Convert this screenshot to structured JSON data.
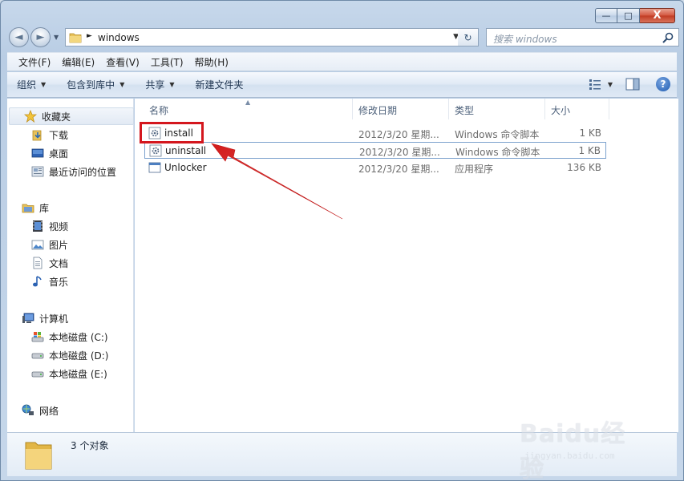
{
  "window": {
    "caption": {
      "minimize": "—",
      "maximize": "□",
      "close": "X"
    }
  },
  "nav": {
    "back_glyph": "◄",
    "forward_glyph": "►",
    "address_path": "windows",
    "refresh_glyph": "↻",
    "search_placeholder": "搜索 windows",
    "icons": {
      "search": "search-icon",
      "folder": "folder-icon"
    }
  },
  "menu": {
    "items": [
      "文件(F)",
      "编辑(E)",
      "查看(V)",
      "工具(T)",
      "帮助(H)"
    ]
  },
  "toolbar": {
    "organize": "组织",
    "include_in_library": "包含到库中",
    "share": "共享",
    "new_folder": "新建文件夹",
    "help": "?"
  },
  "nav_pane": {
    "favorites": {
      "label": "收藏夹",
      "items": [
        "下载",
        "桌面",
        "最近访问的位置"
      ]
    },
    "libraries": {
      "label": "库",
      "items": [
        "视频",
        "图片",
        "文档",
        "音乐"
      ]
    },
    "computer": {
      "label": "计算机",
      "items": [
        "本地磁盘 (C:)",
        "本地磁盘 (D:)",
        "本地磁盘 (E:)"
      ]
    },
    "network": {
      "label": "网络"
    }
  },
  "columns": {
    "name": "名称",
    "date": "修改日期",
    "type": "类型",
    "size": "大小"
  },
  "files": [
    {
      "name": "install",
      "date": "2012/3/20 星期...",
      "type": "Windows 命令脚本",
      "size": "1 KB",
      "icon": "script-gear-icon"
    },
    {
      "name": "uninstall",
      "date": "2012/3/20 星期...",
      "type": "Windows 命令脚本",
      "size": "1 KB",
      "icon": "script-gear-icon"
    },
    {
      "name": "Unlocker",
      "date": "2012/3/20 星期...",
      "type": "应用程序",
      "size": "136 KB",
      "icon": "application-icon"
    }
  ],
  "annotation": {
    "highlight_color": "#d4171e"
  },
  "status": {
    "count": "3 个对象"
  },
  "watermark": {
    "logo": "Baidu经验",
    "url": "jingyan.baidu.com"
  },
  "colors": {
    "accent": "#1d5bb2",
    "selection_border": "#7da2ce",
    "header_text": "#4c607a"
  }
}
